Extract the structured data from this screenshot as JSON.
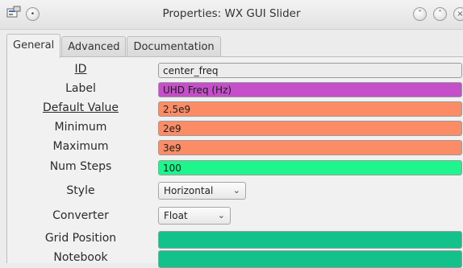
{
  "window": {
    "title": "Properties: WX GUI Slider",
    "icons": [
      "app-icon",
      "window-menu-icon",
      "minimize-icon",
      "maximize-icon",
      "close-icon"
    ]
  },
  "tabs": [
    {
      "label": "General",
      "active": true
    },
    {
      "label": "Advanced",
      "active": false
    },
    {
      "label": "Documentation",
      "active": false
    }
  ],
  "params": {
    "id": {
      "label": "ID",
      "value": "center_freq",
      "color": "#ececec"
    },
    "label": {
      "label": "Label",
      "value": "UHD Freq (Hz)",
      "color": "#c44fc9"
    },
    "default_value": {
      "label": "Default Value",
      "value": "2.5e9",
      "color": "#fb8c66"
    },
    "minimum": {
      "label": "Minimum",
      "value": "2e9",
      "color": "#fb8c66"
    },
    "maximum": {
      "label": "Maximum",
      "value": "3e9",
      "color": "#fb8c66"
    },
    "num_steps": {
      "label": "Num Steps",
      "value": "100",
      "color": "#1ef58c"
    },
    "style": {
      "label": "Style",
      "value": "Horizontal"
    },
    "converter": {
      "label": "Converter",
      "value": "Float"
    },
    "grid_position": {
      "label": "Grid Position",
      "value": "",
      "color": "#12c28a"
    },
    "notebook": {
      "label": "Notebook",
      "value": "",
      "color": "#12c28a"
    }
  }
}
